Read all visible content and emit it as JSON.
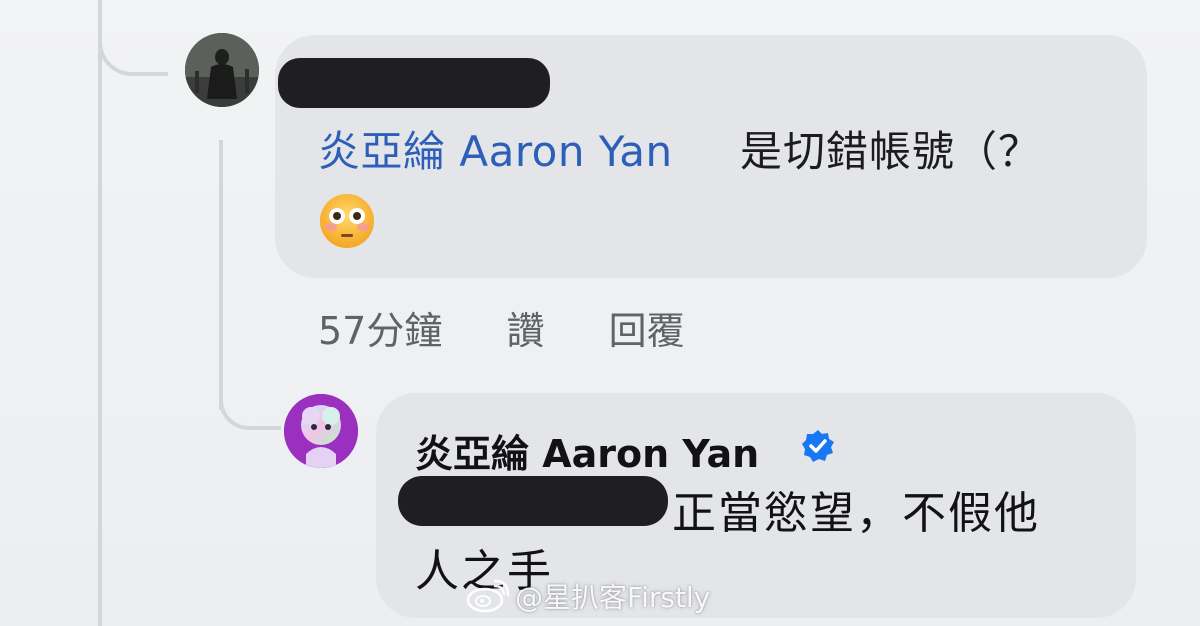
{
  "comment": {
    "mention_text": "炎亞綸 Aaron Yan",
    "body_text": "是切錯帳號（？",
    "emoji": "flushed-face-emoji",
    "meta": {
      "time": "57分鐘",
      "like_label": "讚",
      "reply_label": "回覆"
    }
  },
  "reply": {
    "author_name": "炎亞綸 Aaron Yan",
    "verified": true,
    "body_line1": "正當慾望，不假他",
    "body_line2": "人之手"
  },
  "watermark": {
    "text": "@星扒客Firstly",
    "icon": "weibo-icon"
  },
  "colors": {
    "bubble": "#e3e5e9",
    "mention": "#2d5fb8",
    "verified": "#1877f2",
    "meta": "#5f6368"
  }
}
